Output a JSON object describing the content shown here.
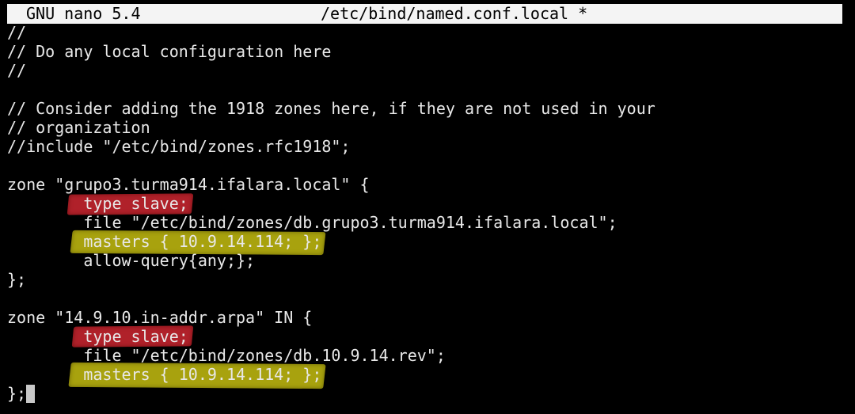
{
  "titlebar": {
    "app": "GNU nano 5.4",
    "file": "/etc/bind/named.conf.local *"
  },
  "editor": {
    "lines": [
      "//",
      "// Do any local configuration here",
      "//",
      "",
      "// Consider adding the 1918 zones here, if they are not used in your",
      "// organization",
      "//include \"/etc/bind/zones.rfc1918\";",
      "",
      "zone \"grupo3.turma914.ifalara.local\" {",
      "        type slave;",
      "        file \"/etc/bind/zones/db.grupo3.turma914.ifalara.local\";",
      "        masters { 10.9.14.114; };",
      "        allow-query{any;};",
      "};",
      "",
      "zone \"14.9.10.in-addr.arpa\" IN {",
      "        type slave;",
      "        file \"/etc/bind/zones/db.10.9.14.rev\";",
      "        masters { 10.9.14.114; };",
      "};"
    ]
  },
  "highlight_colors": {
    "red": "#b0212a",
    "yellow": "#a8a20e"
  }
}
